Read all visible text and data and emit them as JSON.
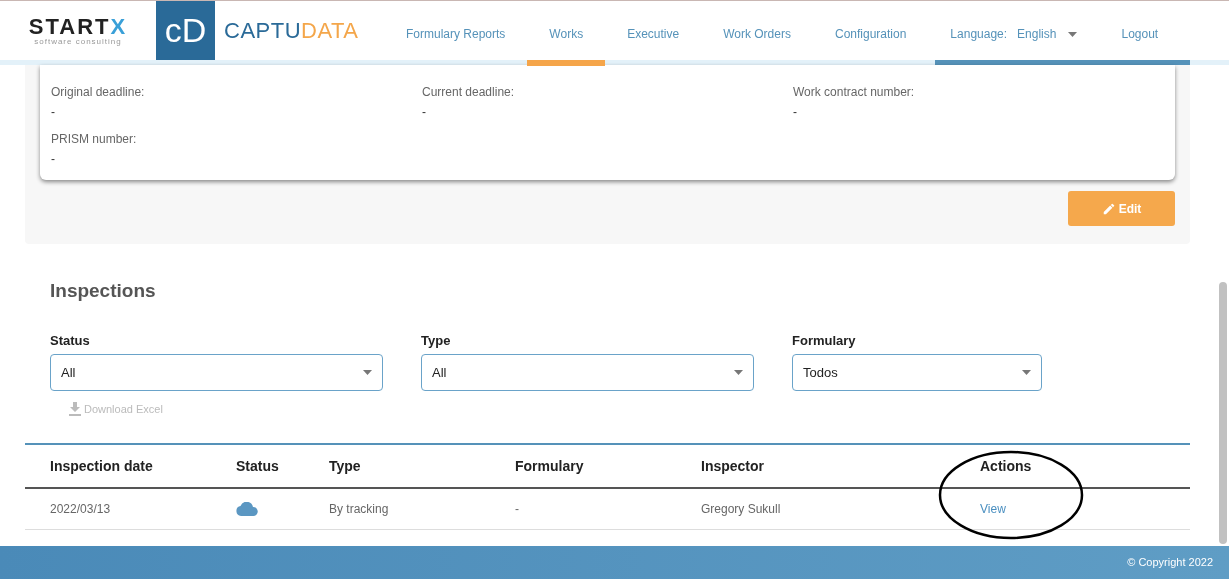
{
  "header": {
    "startx": {
      "main": "START",
      "accent": "X",
      "tagline": "software consulting"
    },
    "logo_mark": "cD",
    "brand": {
      "main": "CAPTU",
      "accent": "DATA"
    },
    "nav": [
      {
        "label": "Formulary Reports",
        "selected": false
      },
      {
        "label": "Works",
        "selected": true
      },
      {
        "label": "Executive",
        "selected": false
      },
      {
        "label": "Work Orders",
        "selected": false
      },
      {
        "label": "Configuration",
        "selected": false
      }
    ],
    "language": {
      "label": "Language:",
      "value": "English"
    },
    "logout": "Logout"
  },
  "details": {
    "fields": [
      {
        "label": "Original deadline:",
        "value": "-"
      },
      {
        "label": "Current deadline:",
        "value": "-"
      },
      {
        "label": "Work contract number:",
        "value": "-"
      },
      {
        "label": "PRISM number:",
        "value": "-"
      }
    ],
    "edit_button": "Edit"
  },
  "inspections": {
    "title": "Inspections",
    "filters": [
      {
        "label": "Status",
        "value": "All"
      },
      {
        "label": "Type",
        "value": "All"
      },
      {
        "label": "Formulary",
        "value": "Todos"
      }
    ],
    "download": {
      "label": "Download Excel",
      "disabled": true
    },
    "table": {
      "columns": [
        "Inspection date",
        "Status",
        "Type",
        "Formulary",
        "Inspector",
        "Actions"
      ],
      "rows": [
        {
          "date": "2022/03/13",
          "kind": "cloud",
          "type": "By tracking",
          "formulary": "-",
          "inspector": "Gregory Sukull",
          "action": "View"
        }
      ]
    }
  },
  "footer": "© Copyright 2022"
}
